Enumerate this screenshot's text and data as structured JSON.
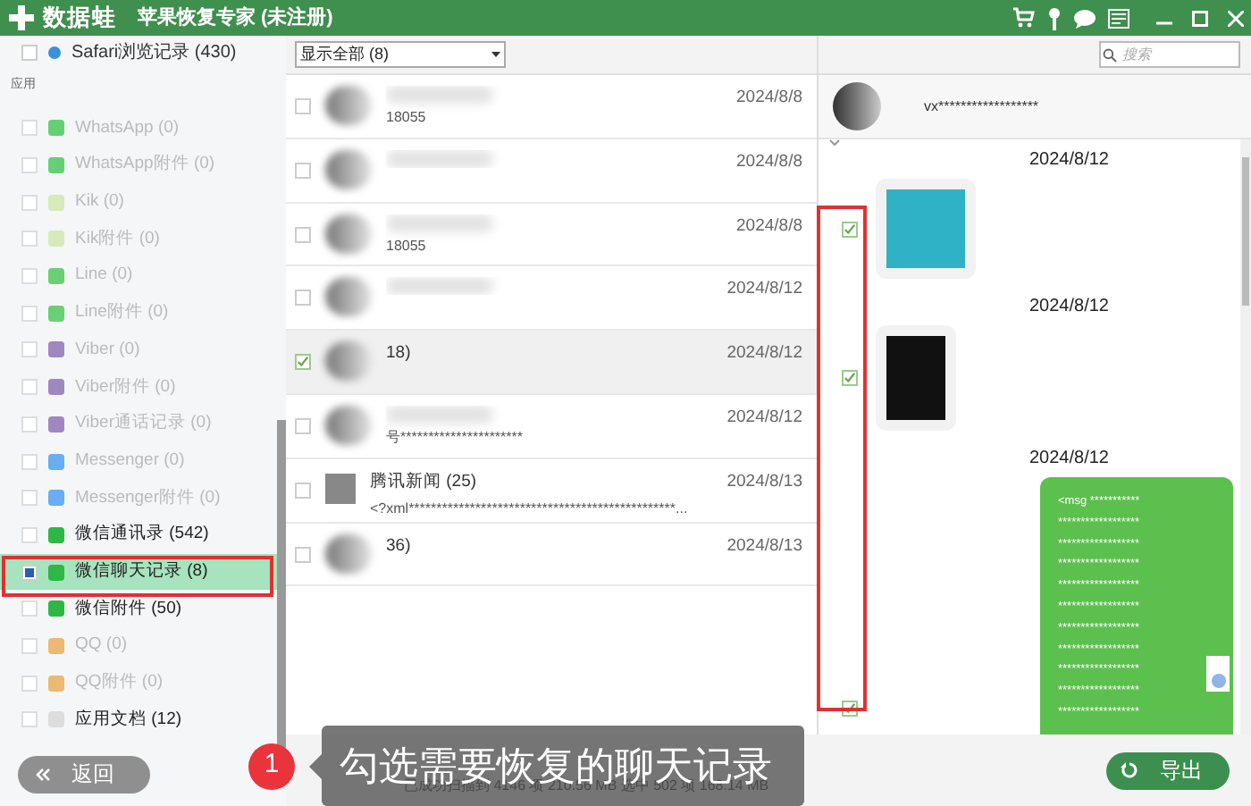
{
  "window": {
    "logo_text": "数据蛙",
    "title": "苹果恢复专家 (未注册)"
  },
  "sidebar": {
    "top_item": {
      "label": "Safari浏览记录 (430)",
      "checked": false
    },
    "section": "应用",
    "items": [
      {
        "label": "WhatsApp (0)",
        "kind": "whatsapp",
        "enabled": false,
        "checked": false,
        "selected": false
      },
      {
        "label": "WhatsApp附件 (0)",
        "kind": "whatsapp",
        "enabled": false,
        "checked": false,
        "selected": false
      },
      {
        "label": "Kik (0)",
        "kind": "kik",
        "enabled": false,
        "checked": false,
        "selected": false
      },
      {
        "label": "Kik附件 (0)",
        "kind": "kik",
        "enabled": false,
        "checked": false,
        "selected": false
      },
      {
        "label": "Line (0)",
        "kind": "line",
        "enabled": false,
        "checked": false,
        "selected": false
      },
      {
        "label": "Line附件 (0)",
        "kind": "line",
        "enabled": false,
        "checked": false,
        "selected": false
      },
      {
        "label": "Viber (0)",
        "kind": "viber",
        "enabled": false,
        "checked": false,
        "selected": false
      },
      {
        "label": "Viber附件 (0)",
        "kind": "viber",
        "enabled": false,
        "checked": false,
        "selected": false
      },
      {
        "label": "Viber通话记录 (0)",
        "kind": "viber",
        "enabled": false,
        "checked": false,
        "selected": false
      },
      {
        "label": "Messenger (0)",
        "kind": "messenger",
        "enabled": false,
        "checked": false,
        "selected": false
      },
      {
        "label": "Messenger附件 (0)",
        "kind": "messenger",
        "enabled": false,
        "checked": false,
        "selected": false
      },
      {
        "label": "微信通讯录 (542)",
        "kind": "wechat",
        "enabled": true,
        "checked": false,
        "selected": false
      },
      {
        "label": "微信聊天记录 (8)",
        "kind": "wechat",
        "enabled": true,
        "checked": true,
        "selected": true
      },
      {
        "label": "微信附件 (50)",
        "kind": "wechat",
        "enabled": true,
        "checked": false,
        "selected": false
      },
      {
        "label": "QQ (0)",
        "kind": "qq",
        "enabled": false,
        "checked": false,
        "selected": false
      },
      {
        "label": "QQ附件 (0)",
        "kind": "qq",
        "enabled": false,
        "checked": false,
        "selected": false
      },
      {
        "label": "应用文档 (12)",
        "kind": "doc",
        "enabled": true,
        "checked": false,
        "selected": false
      }
    ],
    "back_button": "返回"
  },
  "filter": {
    "value": "显示全部 (8)"
  },
  "search": {
    "placeholder": "搜索"
  },
  "conversations": [
    {
      "preview": "18055",
      "date": "2024/8/8",
      "checked": false,
      "selected": false,
      "kind": "blurred"
    },
    {
      "date": "2024/8/8",
      "checked": false,
      "selected": false,
      "kind": "blurred"
    },
    {
      "preview": "18055",
      "date": "2024/8/8",
      "checked": false,
      "selected": false,
      "kind": "blurred"
    },
    {
      "date": "2024/8/12",
      "checked": false,
      "selected": false,
      "kind": "blurred"
    },
    {
      "name": "18)",
      "date": "2024/8/12",
      "checked": true,
      "selected": true,
      "kind": "blurred"
    },
    {
      "preview": "号**********************",
      "date": "2024/8/12",
      "checked": false,
      "selected": false,
      "kind": "blurred"
    },
    {
      "name": "腾讯新闻 (25)",
      "preview": "<?xml************************************************...",
      "date": "2024/8/13",
      "checked": false,
      "selected": false,
      "kind": "person"
    },
    {
      "name": "36)",
      "date": "2024/8/13",
      "checked": false,
      "selected": false,
      "kind": "blurred"
    }
  ],
  "chat": {
    "contact": "vx******************",
    "messages": [
      {
        "kind": "image",
        "date": "2024/8/12",
        "checked": true
      },
      {
        "kind": "image",
        "date": "2024/8/12",
        "checked": true
      },
      {
        "kind": "text",
        "date": "2024/8/12",
        "checked": true,
        "lines": [
          "<msg ***********",
          "******************",
          "******************",
          "******************",
          "******************",
          "******************",
          "******************",
          "******************",
          "******************",
          "******************",
          "******************"
        ]
      }
    ]
  },
  "status_bar": {
    "text": "已成功扫描到 4146 项 210.56 MB  选中 502 项 168.14 MB",
    "export_button": "导出"
  },
  "tooltip": {
    "number": "1",
    "text": "勾选需要恢复的聊天记录"
  }
}
